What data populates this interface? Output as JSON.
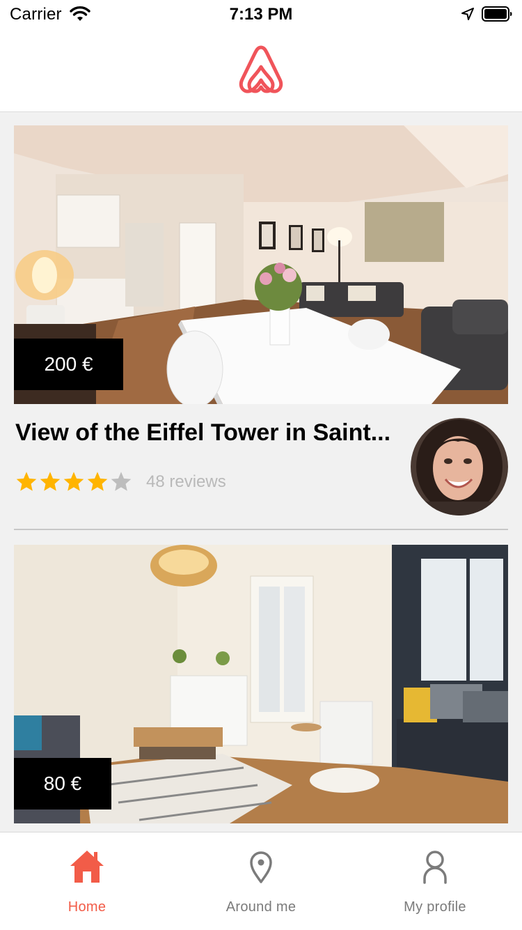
{
  "status_bar": {
    "carrier": "Carrier",
    "time": "7:13 PM",
    "wifi_icon": "wifi-icon",
    "location_icon": "location-arrow-icon",
    "battery_icon": "battery-full-icon"
  },
  "header": {
    "logo_icon": "airbnb-logo-icon"
  },
  "listings": [
    {
      "price": "200 €",
      "title": "View of the Eiffel Tower in Saint...",
      "rating": 4,
      "rating_max": 5,
      "reviews": "48 reviews"
    },
    {
      "price": "80 €"
    }
  ],
  "tabs": [
    {
      "label": "Home",
      "icon": "home-icon",
      "active": true
    },
    {
      "label": "Around me",
      "icon": "map-pin-icon",
      "active": false
    },
    {
      "label": "My profile",
      "icon": "user-icon",
      "active": false
    }
  ],
  "colors": {
    "brand": "#ff5a5f",
    "active_tab": "#f25c48",
    "inactive_tab": "#7b7b7b",
    "star_filled": "#ffb400",
    "star_empty": "#bdbdbd",
    "review_text": "#b9b9b9",
    "price_badge_bg": "#000000",
    "feed_background": "#f1f1f1"
  }
}
